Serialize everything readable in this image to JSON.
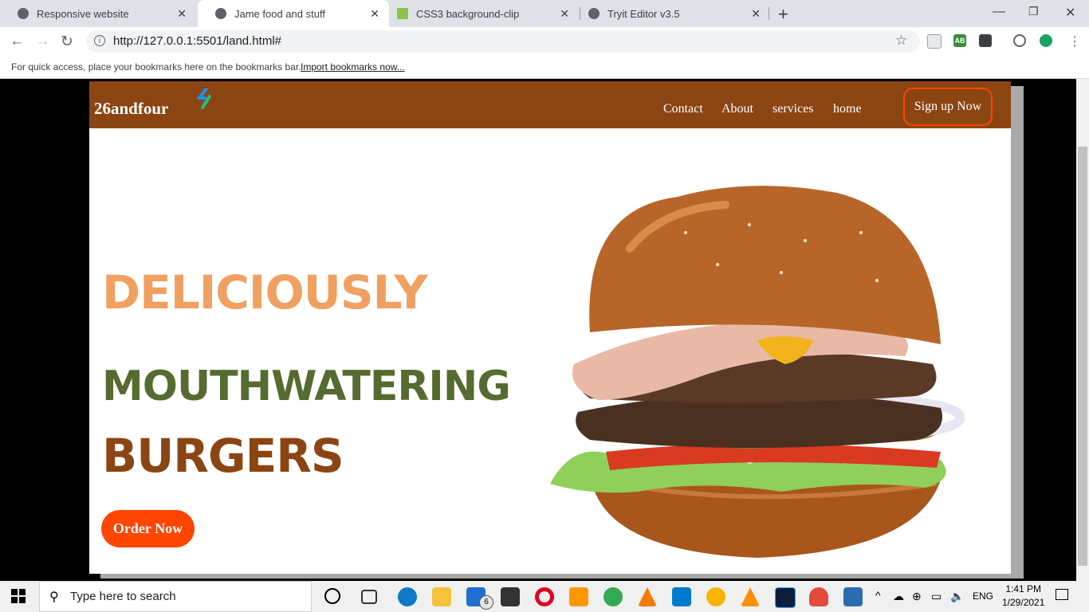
{
  "browser": {
    "tabs": [
      {
        "title": "Responsive website",
        "active": false
      },
      {
        "title": "Jame food and stuff",
        "active": true
      },
      {
        "title": "CSS3 background-clip",
        "active": false
      },
      {
        "title": "Tryit Editor v3.5",
        "active": false
      }
    ],
    "new_tab": "+",
    "url": "http://127.0.0.1:5501/land.html#",
    "bookmarks_message": "For quick access, place your bookmarks here on the bookmarks bar.",
    "bookmarks_link": "Import bookmarks now...",
    "extension_ab": "AB"
  },
  "site": {
    "logo": "26andfour",
    "nav_links": [
      "Contact",
      "About",
      "services",
      "home"
    ],
    "signup": "Sign up Now",
    "hero": {
      "line1": "DELICIOUSLY",
      "line2": "MOUTHWATERING",
      "line3": "BURGERS"
    },
    "order_button": "Order Now",
    "colors": {
      "nav": "#8b4513",
      "line1": "#f0a060",
      "line2": "#556b2f",
      "line3": "#8b4513",
      "accent": "#ff4500"
    }
  },
  "taskbar": {
    "search_placeholder": "Type here to search",
    "mail_badge": "6",
    "language": "ENG",
    "time": "1:41 PM",
    "date": "1/29/2021"
  }
}
